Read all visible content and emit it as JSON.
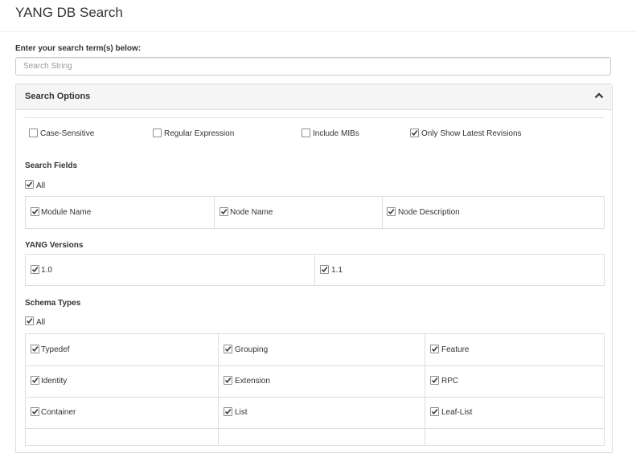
{
  "page": {
    "title": "YANG DB Search"
  },
  "search": {
    "label": "Enter your search term(s) below:",
    "placeholder": "Search String",
    "value": ""
  },
  "options_panel": {
    "title": "Search Options",
    "toggle_icon": "chevron-up-icon",
    "general": [
      {
        "label": "Case-Sensitive",
        "checked": false
      },
      {
        "label": "Regular Expression",
        "checked": false
      },
      {
        "label": "Include MIBs",
        "checked": false
      },
      {
        "label": "Only Show Latest Revisions",
        "checked": true
      }
    ],
    "search_fields": {
      "title": "Search Fields",
      "all": {
        "label": "All",
        "checked": true
      },
      "items": [
        {
          "label": "Module Name",
          "checked": true
        },
        {
          "label": "Node Name",
          "checked": true
        },
        {
          "label": "Node Description",
          "checked": true
        }
      ]
    },
    "yang_versions": {
      "title": "YANG Versions",
      "items": [
        {
          "label": "1.0",
          "checked": true
        },
        {
          "label": "1.1",
          "checked": true
        }
      ]
    },
    "schema_types": {
      "title": "Schema Types",
      "all": {
        "label": "All",
        "checked": true
      },
      "items": [
        {
          "label": "Typedef",
          "checked": true
        },
        {
          "label": "Grouping",
          "checked": true
        },
        {
          "label": "Feature",
          "checked": true
        },
        {
          "label": "Identity",
          "checked": true
        },
        {
          "label": "Extension",
          "checked": true
        },
        {
          "label": "RPC",
          "checked": true
        },
        {
          "label": "Container",
          "checked": true
        },
        {
          "label": "List",
          "checked": true
        },
        {
          "label": "Leaf-List",
          "checked": true
        }
      ]
    }
  }
}
